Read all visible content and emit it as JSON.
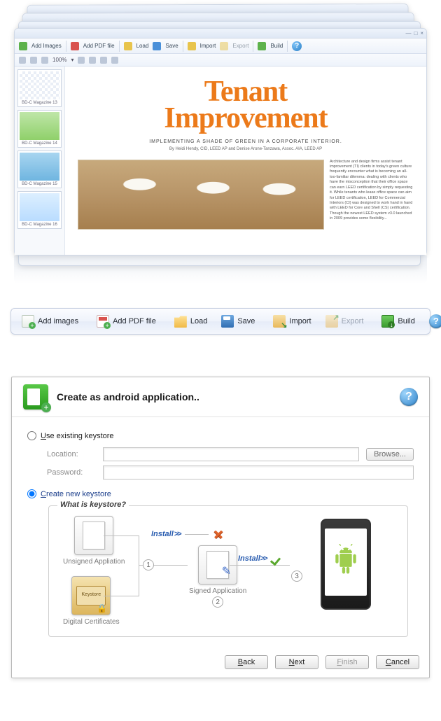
{
  "editor": {
    "toolbar_primary": {
      "add_images": "Add Images",
      "add_pdf": "Add PDF file",
      "load": "Load",
      "save": "Save",
      "import": "Import",
      "export": "Export",
      "build": "Build"
    },
    "zoom": "100%",
    "thumbs": [
      {
        "label": "BD-C Magazine 13"
      },
      {
        "label": "BD-C Magazine 14"
      },
      {
        "label": "BD-C Magazine 15"
      },
      {
        "label": "BD-C Magazine 16"
      }
    ],
    "document": {
      "title_line1": "Tenant",
      "title_line2": "Improvement",
      "subtitle": "IMPLEMENTING A SHADE OF GREEN IN A CORPORATE INTERIOR.",
      "byline": "By Heidi Hendy, CID, LEED AP and Denise Arone-Tanzawa, Assoc. AIA, LEED AP",
      "body": "Architecture and design firms assist tenant improvement (TI) clients in today's green culture frequently encounter what is becoming an all-too-familiar dilemma: dealing with clients who have the misconception that their office space can earn LEED certification by simply requesting it. While tenants who lease office space can aim for LEED certification, LEED for Commercial Interiors (CI) was designed to work hand in hand with LEED for Core and Shell (CS) certification. Though the newest LEED system v3.0 launched in 2009 provides some flexibility..."
    }
  },
  "toolbar": {
    "add_images": "Add images",
    "add_pdf": "Add PDF file",
    "load": "Load",
    "save": "Save",
    "import": "Import",
    "export": "Export",
    "build": "Build"
  },
  "dialog": {
    "title": "Create as android application..",
    "opt_existing": "Use existing keystore",
    "location_label": "Location:",
    "password_label": "Password:",
    "browse": "Browse...",
    "opt_new": "Create new keystore",
    "keystore_legend": "What is keystore?",
    "node_unsigned": "Unsigned Appliation",
    "node_certs": "Digital Certificates",
    "cert_text": "Keystore",
    "node_signed": "Signed Application",
    "install": "Install",
    "step1": "1",
    "step2": "2",
    "step3": "3",
    "btn_back": "Back",
    "btn_next": "Next",
    "btn_finish": "Finish",
    "btn_cancel": "Cancel"
  }
}
